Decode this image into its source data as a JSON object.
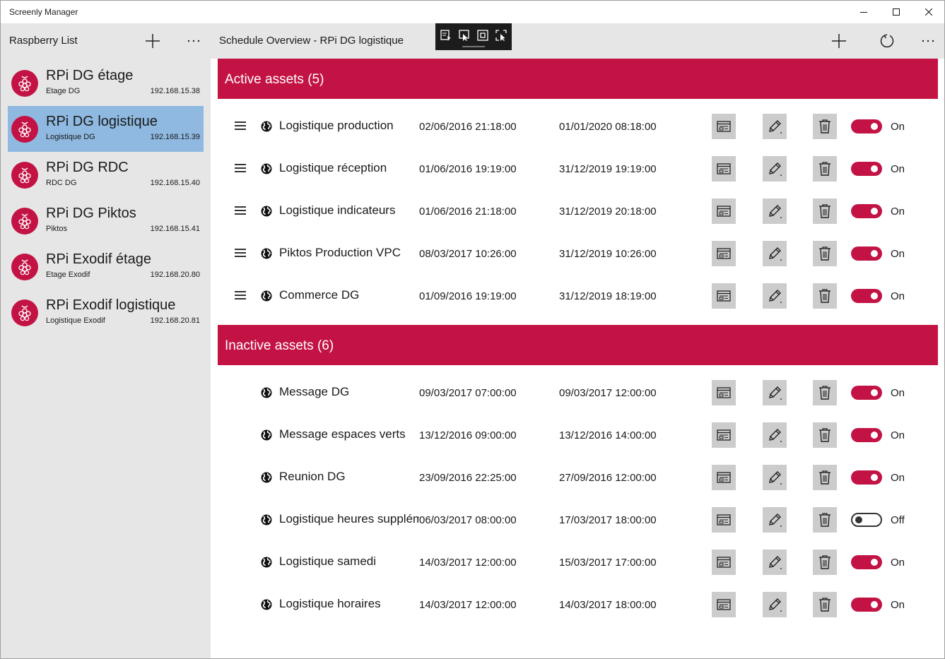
{
  "window": {
    "title": "Screenly Manager"
  },
  "sidebar": {
    "title": "Raspberry List",
    "devices": [
      {
        "name": "RPi DG étage",
        "location": "Etage DG",
        "ip": "192.168.15.38",
        "selected": false
      },
      {
        "name": "RPi DG logistique",
        "location": "Logistique DG",
        "ip": "192.168.15.39",
        "selected": true
      },
      {
        "name": "RPi DG RDC",
        "location": "RDC DG",
        "ip": "192.168.15.40",
        "selected": false
      },
      {
        "name": "RPi DG Piktos",
        "location": "Piktos",
        "ip": "192.168.15.41",
        "selected": false
      },
      {
        "name": "RPi Exodif étage",
        "location": "Etage Exodif",
        "ip": "192.168.20.80",
        "selected": false
      },
      {
        "name": "RPi Exodif logistique",
        "location": "Logistique Exodif",
        "ip": "192.168.20.81",
        "selected": false
      }
    ]
  },
  "main": {
    "title": "Schedule Overview - RPi DG logistique",
    "active_header": "Active assets (5)",
    "inactive_header": "Inactive assets (6)",
    "active": [
      {
        "name": "Logistique production",
        "start": "02/06/2016 21:18:00",
        "end": "01/01/2020 08:18:00",
        "enabled": true,
        "state": "On"
      },
      {
        "name": "Logistique réception",
        "start": "01/06/2016 19:19:00",
        "end": "31/12/2019 19:19:00",
        "enabled": true,
        "state": "On"
      },
      {
        "name": "Logistique indicateurs",
        "start": "01/06/2016 21:18:00",
        "end": "31/12/2019 20:18:00",
        "enabled": true,
        "state": "On"
      },
      {
        "name": "Piktos Production VPC",
        "start": "08/03/2017 10:26:00",
        "end": "31/12/2019 10:26:00",
        "enabled": true,
        "state": "On"
      },
      {
        "name": "Commerce DG",
        "start": "01/09/2016 19:19:00",
        "end": "31/12/2019 18:19:00",
        "enabled": true,
        "state": "On"
      }
    ],
    "inactive": [
      {
        "name": "Message DG",
        "start": "09/03/2017 07:00:00",
        "end": "09/03/2017 12:00:00",
        "enabled": true,
        "state": "On"
      },
      {
        "name": "Message espaces verts",
        "start": "13/12/2016 09:00:00",
        "end": "13/12/2016 14:00:00",
        "enabled": true,
        "state": "On"
      },
      {
        "name": "Reunion DG",
        "start": "23/09/2016 22:25:00",
        "end": "27/09/2016 12:00:00",
        "enabled": true,
        "state": "On"
      },
      {
        "name": "Logistique heures supplémentaires",
        "start": "06/03/2017 08:00:00",
        "end": "17/03/2017 18:00:00",
        "enabled": false,
        "state": "Off"
      },
      {
        "name": "Logistique samedi",
        "start": "14/03/2017 12:00:00",
        "end": "15/03/2017 17:00:00",
        "enabled": true,
        "state": "On"
      },
      {
        "name": "Logistique horaires",
        "start": "14/03/2017 12:00:00",
        "end": "14/03/2017 18:00:00",
        "enabled": true,
        "state": "On"
      }
    ]
  },
  "colors": {
    "accent": "#c31344",
    "selected": "#8fb9e0",
    "panel": "#e6e6e6",
    "action_bg": "#cccccc"
  }
}
